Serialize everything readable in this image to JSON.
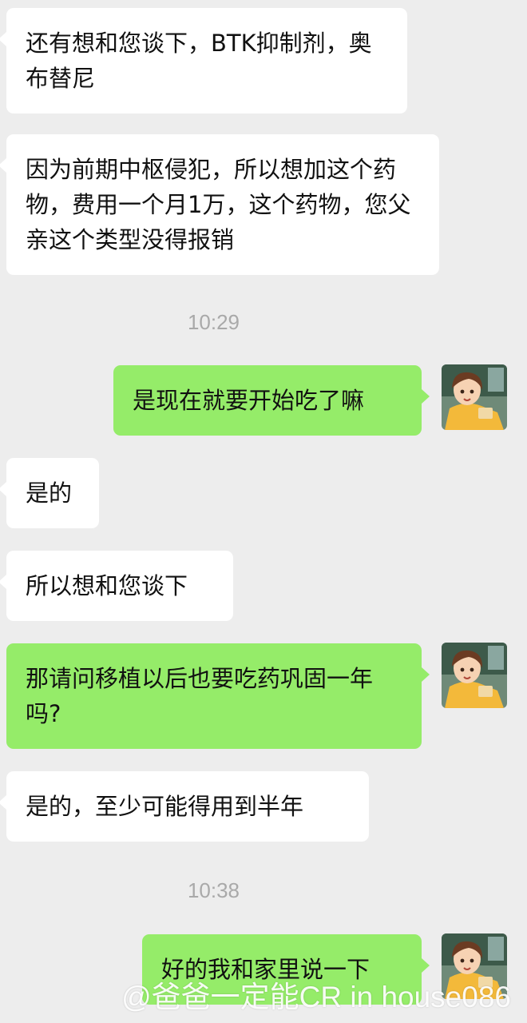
{
  "chat": {
    "messages": [
      {
        "side": "left",
        "text": "还有想和您谈下，BTK抑制剂，奥布替尼"
      },
      {
        "side": "left",
        "text": "因为前期中枢侵犯，所以想加这个药物，费用一个月1万，这个药物，您父亲这个类型没得报销"
      },
      {
        "side": "time",
        "text": "10:29"
      },
      {
        "side": "right",
        "text": "是现在就要开始吃了嘛"
      },
      {
        "side": "left",
        "text": "是的"
      },
      {
        "side": "left",
        "text": "所以想和您谈下"
      },
      {
        "side": "right",
        "text": "那请问移植以后也要吃药巩固一年吗?"
      },
      {
        "side": "left",
        "text": "是的，至少可能得用到半年"
      },
      {
        "side": "time",
        "text": "10:38"
      },
      {
        "side": "right",
        "text": "好的我和家里说一下"
      }
    ]
  },
  "watermark": "@爸爸一定能CR in house086",
  "colors": {
    "background": "#ededed",
    "incoming_bubble": "#ffffff",
    "outgoing_bubble": "#95ec69",
    "timestamp": "#a9a9a9"
  },
  "icons": {
    "avatar": "user-avatar-icon"
  }
}
